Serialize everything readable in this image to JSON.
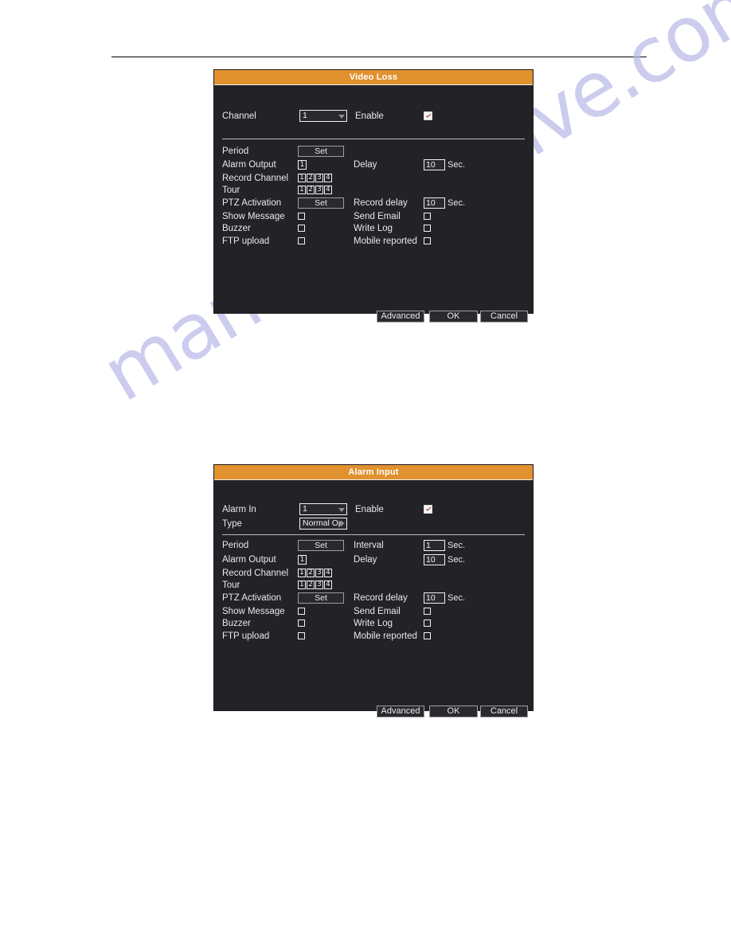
{
  "page": {
    "background": "#ffffff",
    "rule_color": "#000000",
    "watermark_text": "manualsarchive.com",
    "watermark_color": "#b9b9e8"
  },
  "theme": {
    "titlebar_color": "#e2912f",
    "dialog_bg": "#232226",
    "text_color": "#e9e9ec",
    "field_border": "#f2f2f2",
    "check_mark_color": "#a03030"
  },
  "dialogs": [
    {
      "title": "Video Loss",
      "top_fields": {
        "channel_label": "Channel",
        "channel_value": "1",
        "enable_label": "Enable",
        "enable_checked": true
      },
      "rows": {
        "period_label": "Period",
        "period_button": "Set",
        "alarm_output_label": "Alarm Output",
        "alarm_output_value": "1",
        "delay_label": "Delay",
        "delay_value": "10",
        "delay_unit": "Sec.",
        "record_channel_label": "Record Channel",
        "record_channel_values": [
          "1",
          "2",
          "3",
          "4"
        ],
        "tour_label": "Tour",
        "tour_values": [
          "1",
          "2",
          "3",
          "4"
        ],
        "ptz_activation_label": "PTZ Activation",
        "ptz_activation_button": "Set",
        "record_delay_label": "Record delay",
        "record_delay_value": "10",
        "record_delay_unit": "Sec.",
        "show_message_label": "Show Message",
        "send_email_label": "Send Email",
        "buzzer_label": "Buzzer",
        "write_log_label": "Write Log",
        "ftp_upload_label": "FTP upload",
        "mobile_reported_label": "Mobile reported"
      },
      "footer": {
        "advanced": "Advanced",
        "ok": "OK",
        "cancel": "Cancel"
      }
    },
    {
      "title": "Alarm Input",
      "top_fields": {
        "alarm_in_label": "Alarm In",
        "alarm_in_value": "1",
        "enable_label": "Enable",
        "enable_checked": true,
        "type_label": "Type",
        "type_value": "Normal Op"
      },
      "rows": {
        "period_label": "Period",
        "period_button": "Set",
        "interval_label": "Interval",
        "interval_value": "1",
        "interval_unit": "Sec.",
        "alarm_output_label": "Alarm Output",
        "alarm_output_value": "1",
        "delay_label": "Delay",
        "delay_value": "10",
        "delay_unit": "Sec.",
        "record_channel_label": "Record Channel",
        "record_channel_values": [
          "1",
          "2",
          "3",
          "4"
        ],
        "tour_label": "Tour",
        "tour_values": [
          "1",
          "2",
          "3",
          "4"
        ],
        "ptz_activation_label": "PTZ Activation",
        "ptz_activation_button": "Set",
        "record_delay_label": "Record delay",
        "record_delay_value": "10",
        "record_delay_unit": "Sec.",
        "show_message_label": "Show Message",
        "send_email_label": "Send Email",
        "buzzer_label": "Buzzer",
        "write_log_label": "Write Log",
        "ftp_upload_label": "FTP upload",
        "mobile_reported_label": "Mobile reported"
      },
      "footer": {
        "advanced": "Advanced",
        "ok": "OK",
        "cancel": "Cancel"
      }
    }
  ]
}
